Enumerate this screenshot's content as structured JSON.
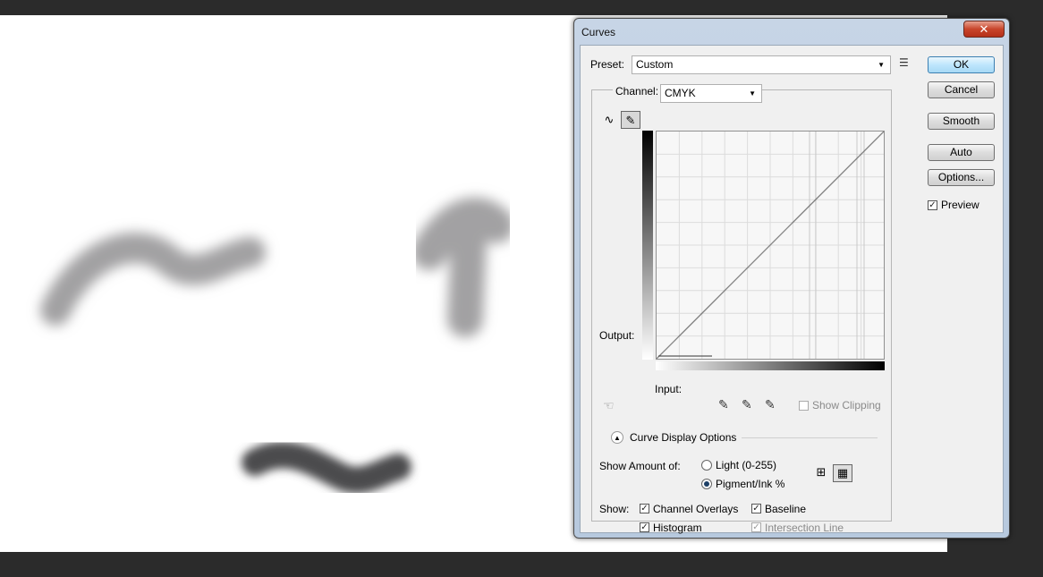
{
  "dialog": {
    "title": "Curves",
    "close_label": "✕"
  },
  "preset": {
    "label": "Preset:",
    "value": "Custom"
  },
  "channel": {
    "label": "Channel:",
    "value": "CMYK"
  },
  "graph": {
    "output_label": "Output:",
    "input_label": "Input:"
  },
  "buttons": {
    "ok": "OK",
    "cancel": "Cancel",
    "smooth": "Smooth",
    "auto": "Auto",
    "options": "Options..."
  },
  "preview": {
    "label": "Preview",
    "checked": true
  },
  "show_clipping": {
    "label": "Show Clipping",
    "checked": false
  },
  "curve_display": {
    "title": "Curve Display Options",
    "show_amount_label": "Show Amount of:",
    "light_label": "Light  (0-255)",
    "pigment_label": "Pigment/Ink %",
    "selected": "pigment",
    "show_label": "Show:",
    "channel_overlays": "Channel Overlays",
    "baseline": "Baseline",
    "histogram": "Histogram",
    "intersection_line": "Intersection Line"
  },
  "icons": {
    "close": "close-icon",
    "preset_menu": "preset-options-icon",
    "curve_tool": "curve-point-tool-icon",
    "pencil_tool": "pencil-tool-icon",
    "hand_tool": "on-image-adjust-icon",
    "black_eyedropper": "eyedropper-black-icon",
    "gray_eyedropper": "eyedropper-gray-icon",
    "white_eyedropper": "eyedropper-white-icon",
    "simple_grid": "simple-grid-icon",
    "detailed_grid": "detailed-grid-icon"
  }
}
